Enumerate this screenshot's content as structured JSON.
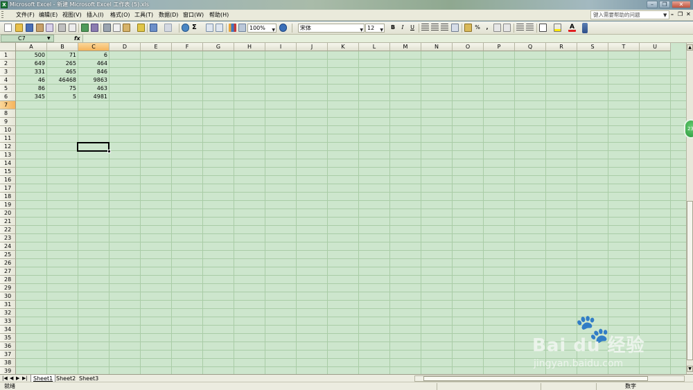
{
  "window": {
    "title": "Microsoft Excel - 新建 Microsoft Excel 工作表 (5).xls"
  },
  "menu": {
    "items": [
      "文件(F)",
      "编辑(E)",
      "视图(V)",
      "插入(I)",
      "格式(O)",
      "工具(T)",
      "数据(D)",
      "窗口(W)",
      "帮助(H)"
    ],
    "help_placeholder": "键入需要帮助的问题"
  },
  "toolbar": {
    "zoom": "100%",
    "font": "宋体",
    "font_size": "12",
    "bold": "B",
    "italic": "I",
    "underline": "U",
    "percent": "%"
  },
  "formula_bar": {
    "name_box": "C7",
    "fx": "fx",
    "content": ""
  },
  "columns": [
    "A",
    "B",
    "C",
    "D",
    "E",
    "F",
    "G",
    "H",
    "I",
    "J",
    "K",
    "L",
    "M",
    "N",
    "O",
    "P",
    "Q",
    "R",
    "S",
    "T",
    "U"
  ],
  "row_numbers": [
    "1",
    "2",
    "3",
    "4",
    "5",
    "6",
    "7",
    "8",
    "9",
    "10",
    "11",
    "12",
    "13",
    "14",
    "15",
    "16",
    "17",
    "18",
    "19",
    "20",
    "21",
    "22",
    "23",
    "24",
    "25",
    "26",
    "27",
    "28",
    "29",
    "30",
    "31",
    "32",
    "33",
    "34",
    "35",
    "36",
    "37",
    "38",
    "39"
  ],
  "cells": [
    [
      "500",
      "71",
      "6"
    ],
    [
      "649",
      "265",
      "464"
    ],
    [
      "331",
      "465",
      "846"
    ],
    [
      "46",
      "46468",
      "9863"
    ],
    [
      "86",
      "75",
      "463"
    ],
    [
      "345",
      "5",
      "4981"
    ]
  ],
  "selected_cell": "C7",
  "sheets": [
    "Sheet1",
    "Sheet2",
    "Sheet3"
  ],
  "active_sheet": "Sheet1",
  "status": {
    "left": "就绪",
    "right": "数字"
  },
  "watermark": {
    "logo": "Bai du 经验",
    "url": "jingyan.baidu.com"
  },
  "side_badge": "23",
  "colors": {
    "grid_bg": "#cde6cd",
    "header_selected": "#f5b45c",
    "gridline": "#a9cca6"
  }
}
